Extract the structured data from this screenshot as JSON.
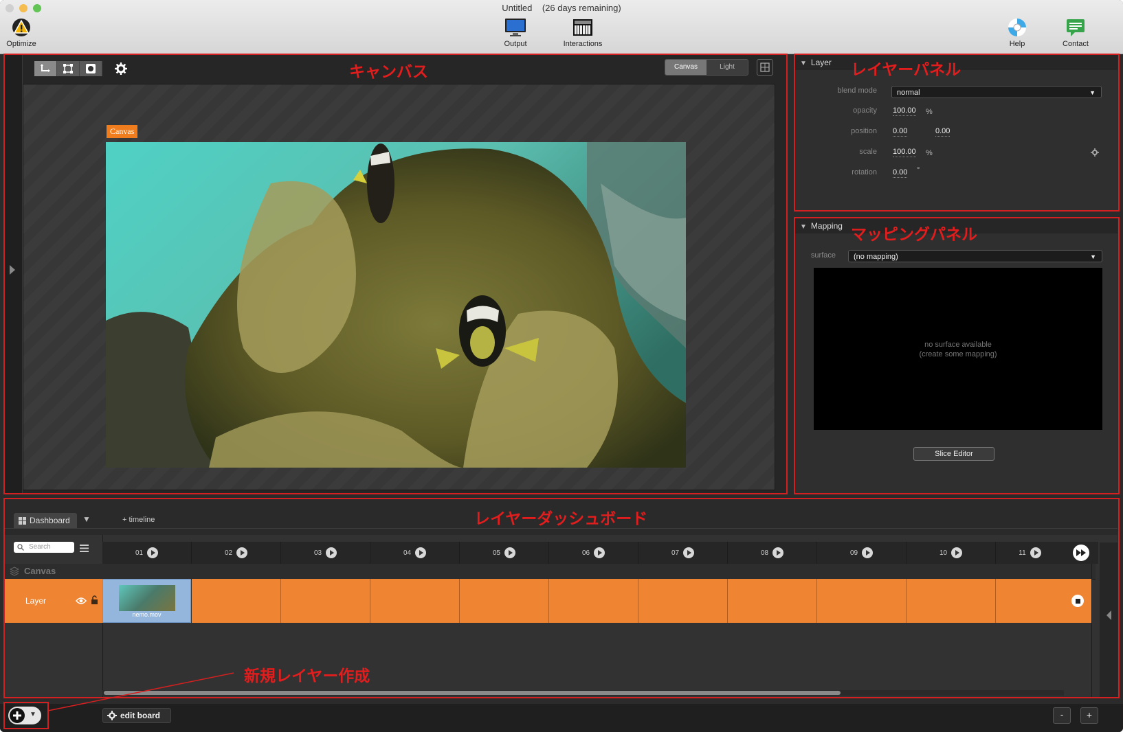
{
  "window": {
    "title": "Untitled",
    "subtitle": "(26 days remaining)"
  },
  "toolbar": {
    "optimize": "Optimize",
    "output": "Output",
    "interactions": "Interactions",
    "help": "Help",
    "contact": "Contact"
  },
  "annotations": {
    "canvas": "キャンバス",
    "layer_panel": "レイヤーパネル",
    "mapping_panel": "マッピングパネル",
    "dashboard": "レイヤーダッシュボード",
    "new_layer": "新規レイヤー作成"
  },
  "canvas": {
    "segments": [
      "Canvas",
      "Light"
    ],
    "active_segment": "Canvas",
    "label": "Canvas"
  },
  "layer_panel": {
    "title": "Layer",
    "blend_mode_label": "blend mode",
    "blend_mode": "normal",
    "opacity_label": "opacity",
    "opacity": "100.00",
    "opacity_unit": "%",
    "position_label": "position",
    "position_x": "0.00",
    "position_y": "0.00",
    "scale_label": "scale",
    "scale": "100.00",
    "scale_unit": "%",
    "rotation_label": "rotation",
    "rotation": "0.00",
    "rotation_unit": "°"
  },
  "mapping_panel": {
    "title": "Mapping",
    "surface_label": "surface",
    "surface": "(no mapping)",
    "empty_line1": "no surface available",
    "empty_line2": "(create some mapping)",
    "slice_editor": "Slice Editor"
  },
  "dashboard": {
    "tab": "Dashboard",
    "add_timeline": "+ timeline",
    "search_placeholder": "Search",
    "columns": [
      "01",
      "02",
      "03",
      "04",
      "05",
      "06",
      "07",
      "08",
      "09",
      "10",
      "11"
    ],
    "group": "Canvas",
    "layer_name": "Layer",
    "clip_name": "nemo.mov"
  },
  "bottom": {
    "edit_board": "edit board",
    "minus": "-",
    "plus": "+"
  },
  "colors": {
    "accent_orange": "#ef8533",
    "annotation_red": "#d42020"
  }
}
